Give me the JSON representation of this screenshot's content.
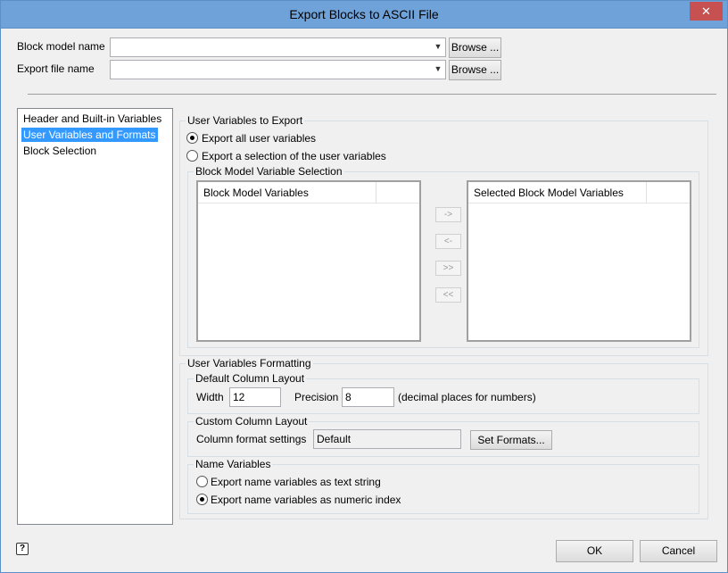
{
  "window": {
    "title": "Export Blocks to ASCII File",
    "close_label": "✕"
  },
  "top_fields": {
    "block_model_label": "Block model name",
    "block_model_value": "",
    "export_file_label": "Export file name",
    "export_file_value": "",
    "browse_label": "Browse ..."
  },
  "sidebar": {
    "items": [
      {
        "label": "Header and Built-in Variables",
        "selected": false
      },
      {
        "label": "User Variables and Formats",
        "selected": true
      },
      {
        "label": "Block Selection",
        "selected": false
      }
    ]
  },
  "export_group": {
    "title": "User Variables to Export",
    "option_all": "Export all user variables",
    "option_selection": "Export a selection of the user variables",
    "selected_option": "all"
  },
  "variable_selection": {
    "title": "Block Model Variable Selection",
    "left_header": "Block Model Variables",
    "right_header": "Selected Block Model Variables",
    "move_right": "->",
    "move_left": "<-",
    "move_all_right": ">>",
    "move_all_left": "<<"
  },
  "formatting": {
    "title": "User Variables Formatting",
    "default_layout_title": "Default Column Layout",
    "width_label": "Width",
    "width_value": "12",
    "precision_label": "Precision",
    "precision_value": "8",
    "precision_hint": "(decimal places for numbers)",
    "custom_layout_title": "Custom Column Layout",
    "column_format_label": "Column format settings",
    "column_format_value": "Default",
    "set_formats_label": "Set Formats...",
    "name_vars_title": "Name Variables",
    "name_as_text": "Export name variables as text string",
    "name_as_index": "Export name variables as numeric index",
    "name_selected": "index"
  },
  "footer": {
    "help_icon_glyph": "?",
    "ok_label": "OK",
    "cancel_label": "Cancel"
  }
}
